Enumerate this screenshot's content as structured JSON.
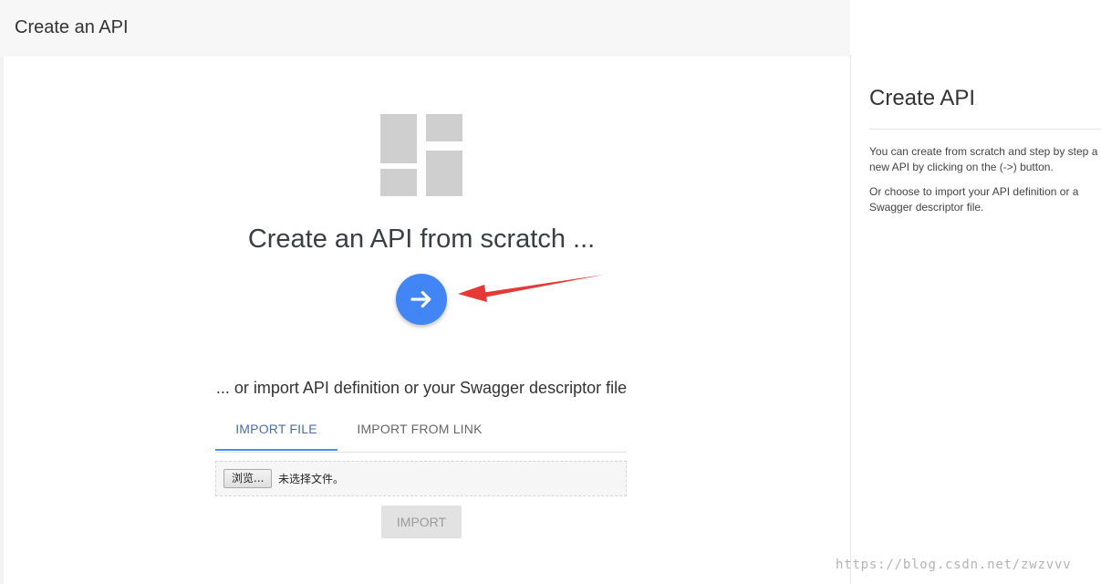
{
  "header": {
    "title": "Create an API"
  },
  "hero": {
    "logo_icon": "dashboard-layout-icon",
    "title": "Create an API from scratch ...",
    "go_button_icon": "arrow-right-icon",
    "accent_color": "#4285f4"
  },
  "import_section": {
    "subtitle": "... or import API definition or your Swagger descriptor file",
    "tabs": [
      {
        "label": "IMPORT FILE",
        "active": true
      },
      {
        "label": "IMPORT FROM LINK",
        "active": false
      }
    ],
    "file_input": {
      "browse_label": "浏览...",
      "status": "未选择文件。"
    },
    "import_button": "IMPORT"
  },
  "sidebar": {
    "title": "Create API",
    "paragraphs": [
      "You can create from scratch and step by step a new API by clicking on the (->) button.",
      "Or choose to import your API definition or a Swagger descriptor file."
    ]
  },
  "annotation": {
    "arrow_color": "#e53935"
  },
  "watermark": "https://blog.csdn.net/zwzvvv"
}
